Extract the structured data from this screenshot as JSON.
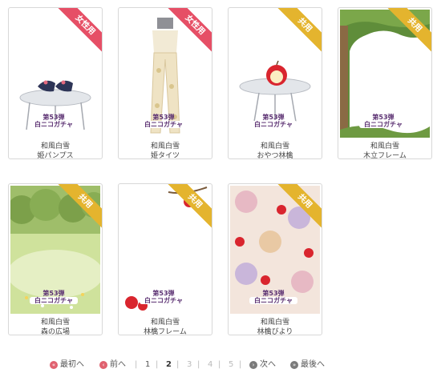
{
  "items": [
    {
      "ribbon": "女性用",
      "line1": "和風白雪",
      "line2": "姫パンプス",
      "badge1": "第53弾",
      "badge2": "白ニコガチャ"
    },
    {
      "ribbon": "女性用",
      "line1": "和風白雪",
      "line2": "姫タイツ",
      "badge1": "第53弾",
      "badge2": "白ニコガチャ"
    },
    {
      "ribbon": "共用",
      "line1": "和風白雪",
      "line2": "おやつ林檎",
      "badge1": "第53弾",
      "badge2": "白ニコガチャ"
    },
    {
      "ribbon": "共用",
      "line1": "和風白雪",
      "line2": "木立フレーム",
      "badge1": "第53弾",
      "badge2": "白ニコガチャ"
    },
    {
      "ribbon": "共用",
      "line1": "和風白雪",
      "line2": "森の広場",
      "badge1": "第53弾",
      "badge2": "白ニコガチャ"
    },
    {
      "ribbon": "共用",
      "line1": "和風白雪",
      "line2": "林檎フレーム",
      "badge1": "第53弾",
      "badge2": "白ニコガチャ"
    },
    {
      "ribbon": "共用",
      "line1": "和風白雪",
      "line2": "林檎びより",
      "badge1": "第53弾",
      "badge2": "白ニコガチャ"
    }
  ],
  "pager": {
    "first": "最初へ",
    "prev": "前へ",
    "next": "次へ",
    "last": "最後へ",
    "pages": [
      "1",
      "2",
      "3",
      "4",
      "5"
    ],
    "current": "2",
    "sep": "|"
  },
  "colors": {
    "female_ribbon": "#e64f66",
    "shared_ribbon": "#e4b42e",
    "badge_text": "#5a2f71"
  }
}
